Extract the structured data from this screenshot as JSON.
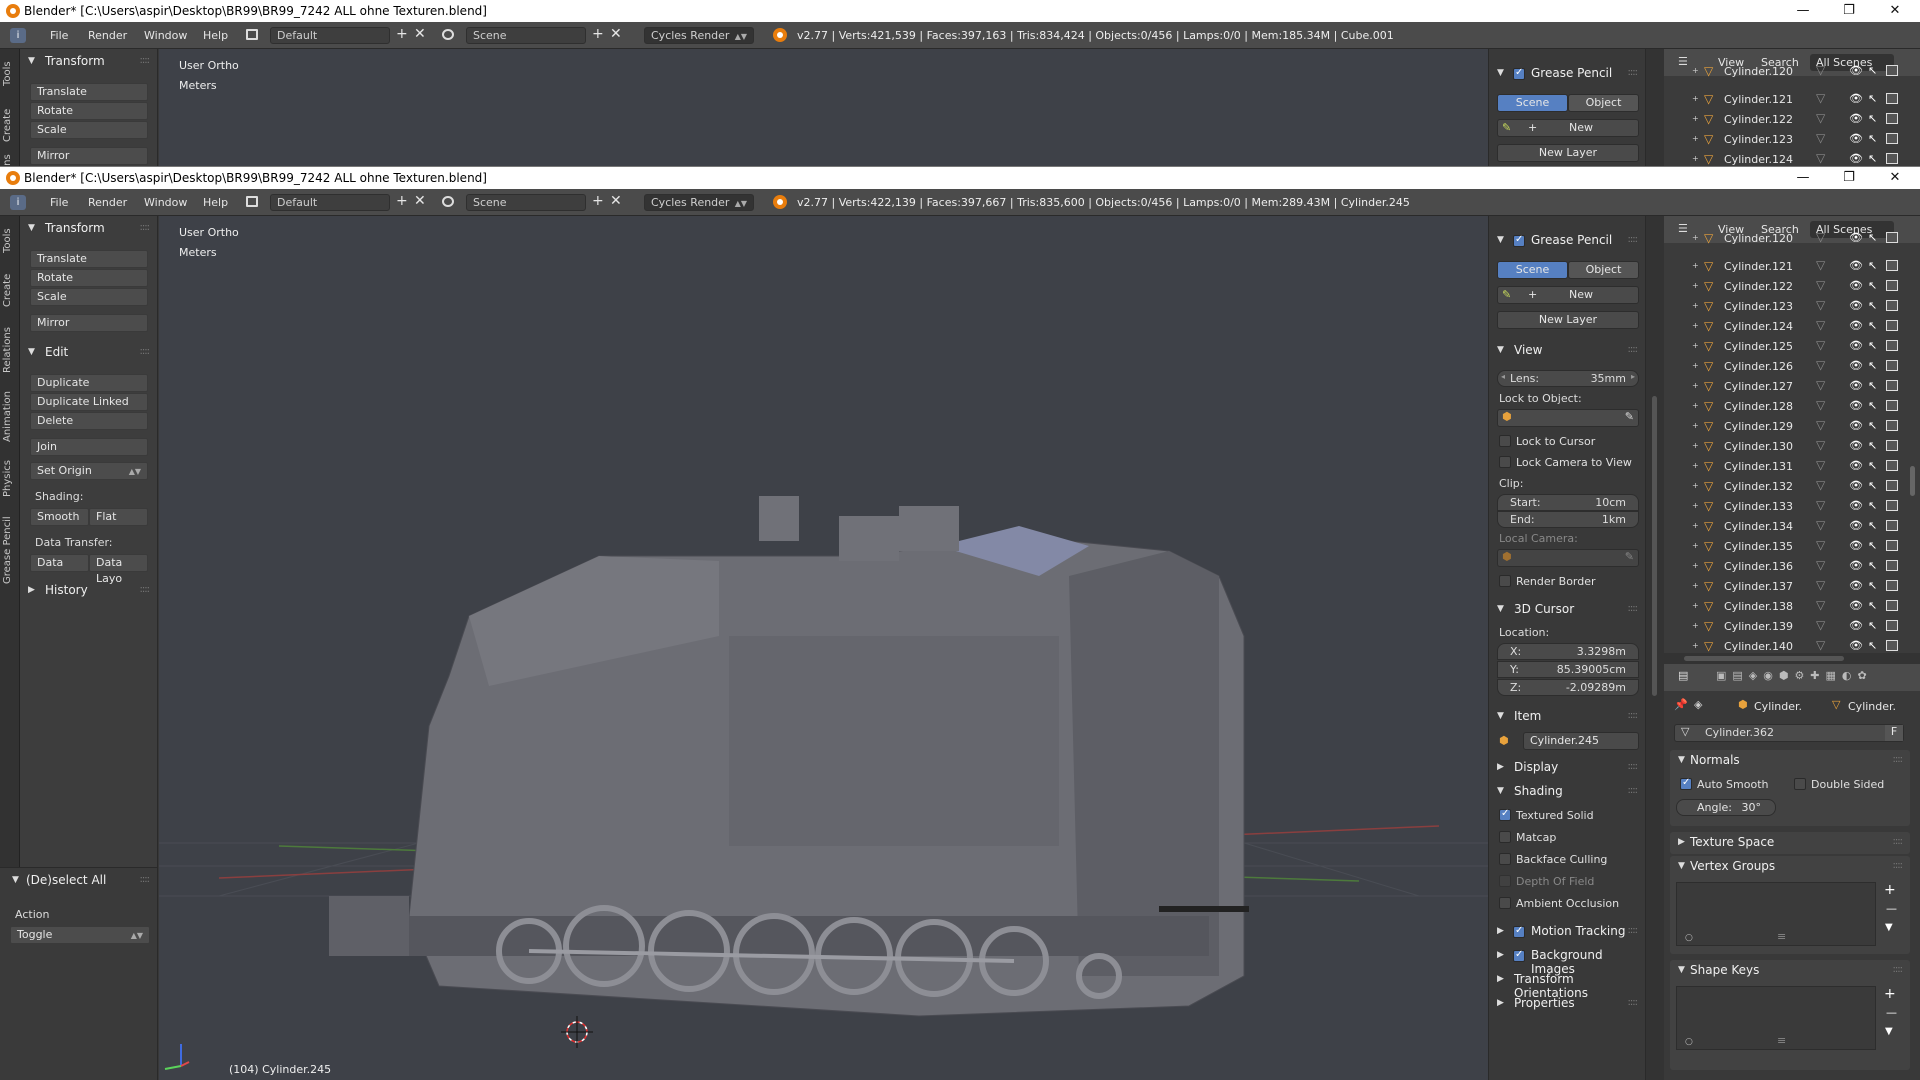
{
  "title_w1": "Blender* [C:\\Users\\aspir\\Desktop\\BR99\\BR99_7242 ALL ohne Texturen.blend]",
  "title_w2": "Blender* [C:\\Users\\aspir\\Desktop\\BR99\\BR99_7242 ALL ohne Texturen.blend]",
  "menu": {
    "file": "File",
    "render": "Render",
    "window": "Window",
    "help": "Help"
  },
  "screen_layout": "Default",
  "scene": "Scene",
  "engine": "Cycles Render",
  "stats_w1": "v2.77 | Verts:421,539 | Faces:397,163 | Tris:834,424 | Objects:0/456 | Lamps:0/0 | Mem:185.34M | Cube.001",
  "stats_w2": "v2.77 | Verts:422,139 | Faces:397,667 | Tris:835,600 | Objects:0/456 | Lamps:0/0 | Mem:289.43M | Cylinder.245",
  "vtabs": [
    "Tools",
    "Create",
    "Relations",
    "Animation",
    "Physics",
    "Grease Pencil"
  ],
  "vtabs_w1": [
    "Tools",
    "Create",
    "ons"
  ],
  "toolshelf": {
    "transform": "Transform",
    "translate": "Translate",
    "rotate": "Rotate",
    "scale": "Scale",
    "mirror": "Mirror",
    "edit": "Edit",
    "duplicate": "Duplicate",
    "duplicate_linked": "Duplicate Linked",
    "delete": "Delete",
    "join": "Join",
    "set_origin": "Set Origin",
    "shading": "Shading:",
    "smooth": "Smooth",
    "flat": "Flat",
    "data_transfer": "Data Transfer:",
    "data": "Data",
    "data_layo": "Data Layo",
    "history": "History",
    "deselect_all": "(De)select All",
    "action": "Action",
    "toggle": "Toggle"
  },
  "viewport": {
    "view": "User Ortho",
    "units": "Meters",
    "object_info": "(104) Cylinder.245"
  },
  "npanel": {
    "grease_pencil": "Grease Pencil",
    "scene_btn": "Scene",
    "object_btn": "Object",
    "new": "New",
    "new_layer": "New Layer",
    "view": "View",
    "lens_label": "Lens:",
    "lens_value": "35mm",
    "lock_to_object": "Lock to Object:",
    "lock_to_cursor": "Lock to Cursor",
    "lock_camera": "Lock Camera to View",
    "clip": "Clip:",
    "start_label": "Start:",
    "start_value": "10cm",
    "end_label": "End:",
    "end_value": "1km",
    "local_camera": "Local Camera:",
    "render_border": "Render Border",
    "cursor3d": "3D Cursor",
    "location": "Location:",
    "x_label": "X:",
    "x_value": "3.3298m",
    "y_label": "Y:",
    "y_value": "85.39005cm",
    "z_label": "Z:",
    "z_value": "-2.09289m",
    "item": "Item",
    "item_name": "Cylinder.245",
    "display": "Display",
    "shading": "Shading",
    "textured_solid": "Textured Solid",
    "matcap": "Matcap",
    "backface": "Backface Culling",
    "dof": "Depth Of Field",
    "ao": "Ambient Occlusion",
    "motion_tracking": "Motion Tracking",
    "bg_images": "Background Images",
    "transform_orient": "Transform Orientations",
    "properties": "Properties"
  },
  "outliner": {
    "view": "View",
    "search": "Search",
    "all_scenes": "All Scenes",
    "items_w1": [
      "Cylinder.120",
      "Cylinder.121",
      "Cylinder.122",
      "Cylinder.123",
      "Cylinder.124"
    ],
    "items_w2": [
      "Cylinder.120",
      "Cylinder.121",
      "Cylinder.122",
      "Cylinder.123",
      "Cylinder.124",
      "Cylinder.125",
      "Cylinder.126",
      "Cylinder.127",
      "Cylinder.128",
      "Cylinder.129",
      "Cylinder.130",
      "Cylinder.131",
      "Cylinder.132",
      "Cylinder.133",
      "Cylinder.134",
      "Cylinder.135",
      "Cylinder.136",
      "Cylinder.137",
      "Cylinder.138",
      "Cylinder.139",
      "Cylinder.140"
    ]
  },
  "props": {
    "crumb1": "Cylinder.",
    "crumb2": "Cylinder.",
    "mesh_name": "Cylinder.362",
    "f_btn": "F",
    "normals": "Normals",
    "auto_smooth": "Auto Smooth",
    "double_sided": "Double Sided",
    "angle_label": "Angle:",
    "angle_value": "30°",
    "texture_space": "Texture Space",
    "vertex_groups": "Vertex Groups",
    "shape_keys": "Shape Keys"
  },
  "colors": {
    "accent": "#5680c2",
    "blender_orange": "#e87d0d",
    "viewport_bg": "#3e4148"
  }
}
